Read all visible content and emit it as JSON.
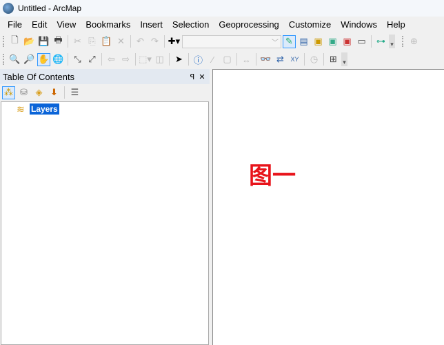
{
  "window": {
    "title": "Untitled - ArcMap"
  },
  "menu": [
    "File",
    "Edit",
    "View",
    "Bookmarks",
    "Insert",
    "Selection",
    "Geoprocessing",
    "Customize",
    "Windows",
    "Help"
  ],
  "toc": {
    "title": "Table Of Contents",
    "pin": "ꟼ",
    "close": "✕",
    "layers_label": "Layers"
  },
  "map": {
    "annotation": "图一"
  },
  "colors": {
    "selection": "#0a64d8",
    "annotation": "#e8141b"
  }
}
